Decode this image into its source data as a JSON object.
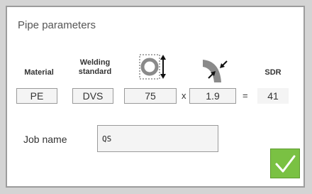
{
  "dialog": {
    "title": "Pipe parameters"
  },
  "headers": {
    "material": "Material",
    "welding_line1": "Welding",
    "welding_line2": "standard",
    "sdr": "SDR"
  },
  "icons": {
    "diameter": "pipe-diameter-icon",
    "thickness": "wall-thickness-icon",
    "confirm": "checkmark-icon"
  },
  "values": {
    "material": "PE",
    "welding_standard": "DVS",
    "diameter": "75",
    "times": "x",
    "wall_thickness": "1.9",
    "equals": "=",
    "sdr": "41"
  },
  "job": {
    "label": "Job name",
    "value": "QS"
  },
  "colors": {
    "confirm_green": "#7ac143"
  }
}
